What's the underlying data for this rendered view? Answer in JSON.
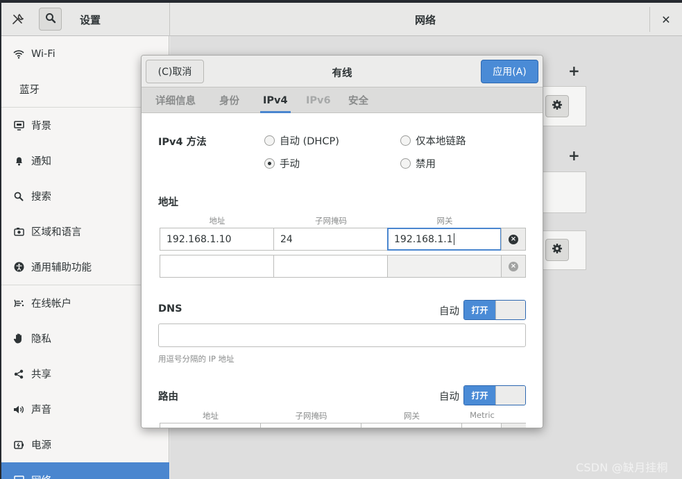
{
  "window": {
    "left_title": "设置",
    "center_title": "网络",
    "close_glyph": "✕"
  },
  "sidebar": {
    "items": [
      {
        "label": "Wi-Fi",
        "icon": "wifi-icon"
      },
      {
        "label": "蓝牙",
        "icon": ""
      },
      {
        "label": "背景",
        "icon": "background-icon"
      },
      {
        "label": "通知",
        "icon": "bell-icon"
      },
      {
        "label": "搜索",
        "icon": "search-icon"
      },
      {
        "label": "区域和语言",
        "icon": "camera-icon"
      },
      {
        "label": "通用辅助功能",
        "icon": "accessibility-icon"
      },
      {
        "label": "在线帐户",
        "icon": "online-accounts-icon"
      },
      {
        "label": "隐私",
        "icon": "hand-icon"
      },
      {
        "label": "共享",
        "icon": "share-icon"
      },
      {
        "label": "声音",
        "icon": "speaker-icon"
      },
      {
        "label": "电源",
        "icon": "power-icon"
      },
      {
        "label": "网络",
        "icon": "network-icon"
      }
    ]
  },
  "background_panel": {
    "plus_glyph": "+"
  },
  "dialog": {
    "cancel_label": "(C)取消",
    "title": "有线",
    "apply_label": "应用(A)",
    "tabs": [
      "详细信息",
      "身份",
      "IPv4",
      "IPv6",
      "安全"
    ],
    "active_tab": "IPv4",
    "ipv4_method_label": "IPv4 方法",
    "methods": {
      "auto_dhcp": "自动 (DHCP)",
      "link_local": "仅本地链路",
      "manual": "手动",
      "disabled": "禁用"
    },
    "selected_method": "手动",
    "address_section": {
      "title": "地址",
      "col_address": "地址",
      "col_netmask": "子网掩码",
      "col_gateway": "网关",
      "rows": [
        {
          "address": "192.168.1.10",
          "netmask": "24",
          "gateway": "192.168.1.1"
        },
        {
          "address": "",
          "netmask": "",
          "gateway": ""
        }
      ]
    },
    "dns": {
      "title": "DNS",
      "auto_label": "自动",
      "switch_label": "打开",
      "switch_on": true,
      "value": "",
      "hint": "用逗号分隔的 IP 地址"
    },
    "routes": {
      "title": "路由",
      "auto_label": "自动",
      "switch_label": "打开",
      "switch_on": true,
      "col_address": "地址",
      "col_netmask": "子网掩码",
      "col_gateway": "网关",
      "col_metric": "Metric"
    }
  },
  "watermark": "CSDN @缺月挂桐",
  "colors": {
    "accent": "#4a86cf",
    "apply_button": "#4a8bd6"
  }
}
